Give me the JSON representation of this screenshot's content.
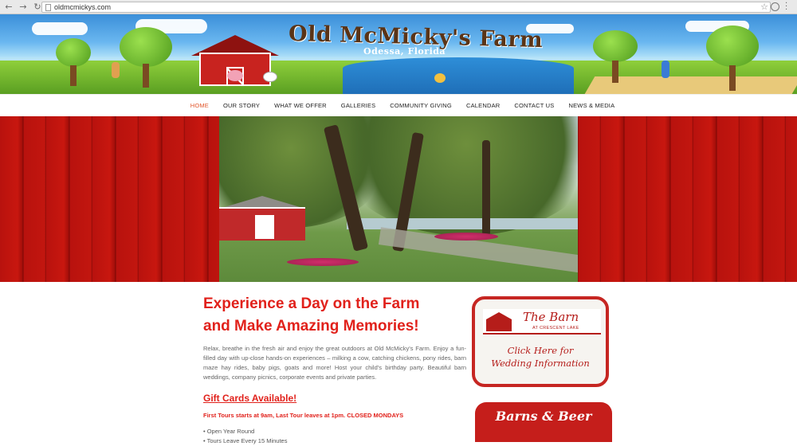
{
  "browser": {
    "url": "oldmcmickys.com",
    "back_glyph": "←",
    "forward_glyph": "→",
    "reload_glyph": "↻",
    "star_glyph": "☆"
  },
  "header": {
    "title": "Old McMicky's Farm",
    "subtitle": "Odessa, Florida"
  },
  "nav": {
    "items": [
      {
        "label": "HOME"
      },
      {
        "label": "OUR STORY"
      },
      {
        "label": "WHAT WE OFFER"
      },
      {
        "label": "GALLERIES"
      },
      {
        "label": "COMMUNITY GIVING"
      },
      {
        "label": "CALENDAR"
      },
      {
        "label": "CONTACT US"
      },
      {
        "label": "NEWS & MEDIA"
      }
    ],
    "active_color": "#e2562b"
  },
  "main": {
    "headline_line1": "Experience a Day on the Farm",
    "headline_line2": "and Make Amazing Memories!",
    "intro": "Relax, breathe in the fresh air and enjoy the great outdoors at Old McMicky's Farm. Enjoy a fun-filled day with up-close hands-on experiences – milking a cow, catching chickens, pony rides, barn maze hay rides, baby pigs, goats and more! Host your child's birthday party. Beautiful barn weddings, company picnics, corporate events and private parties.",
    "gift_cards": "Gift Cards Available!",
    "tours": "First Tours starts at 9am, Last Tour leaves at 1pm. CLOSED MONDAYS",
    "bullets": [
      "• Open Year Round",
      "• Tours Leave Every 15 Minutes"
    ]
  },
  "sidebar": {
    "barn_title": "The Barn",
    "barn_subtitle": "AT CRESCENT LAKE",
    "barn_cta_line1": "Click Here for",
    "barn_cta_line2": "Wedding Information",
    "beer_title": "Barns & Beer"
  },
  "colors": {
    "accent_red": "#e1211b",
    "barn_red": "#c62622"
  }
}
